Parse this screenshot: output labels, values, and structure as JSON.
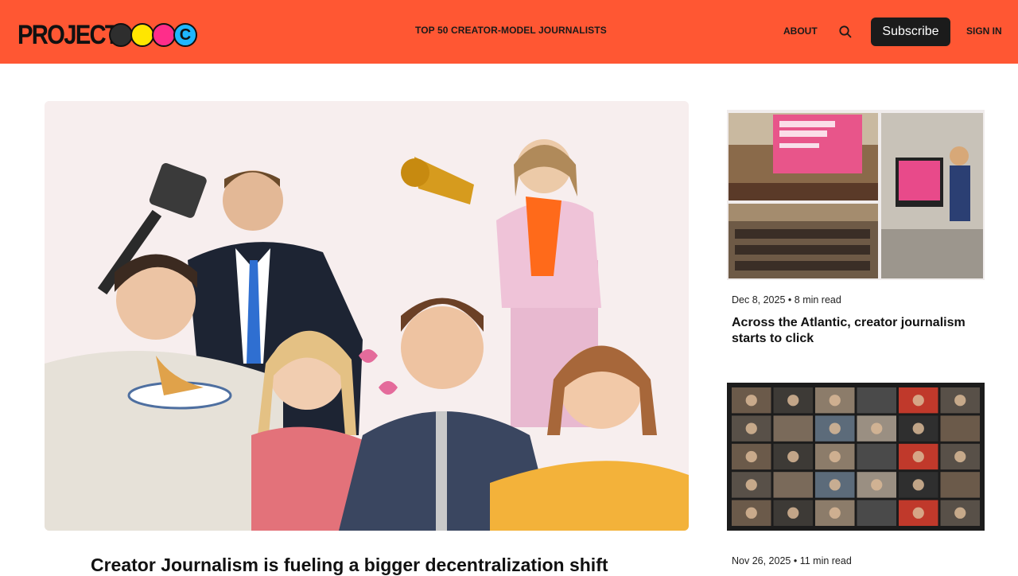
{
  "header": {
    "logo_text": "PROJECT",
    "logo_badge": "C",
    "nav_center": "TOP 50 CREATOR-MODEL JOURNALISTS",
    "about": "ABOUT",
    "subscribe": "Subscribe",
    "sign_in": "SIGN IN",
    "brand_color": "#ff5733",
    "logo_dot_colors": [
      "#2e2e2e",
      "#ffe600",
      "#ff2d8a",
      "#1fb6ff"
    ]
  },
  "hero": {
    "title": "Creator Journalism is fueling a bigger decentralization shift"
  },
  "side_cards": [
    {
      "date": "Dec 8, 2025",
      "read_time": "8 min read",
      "title": "Across the Atlantic, creator journalism starts to click"
    },
    {
      "date": "Nov 26, 2025",
      "read_time": "11 min read"
    }
  ],
  "icons": {
    "search": "search-icon"
  }
}
